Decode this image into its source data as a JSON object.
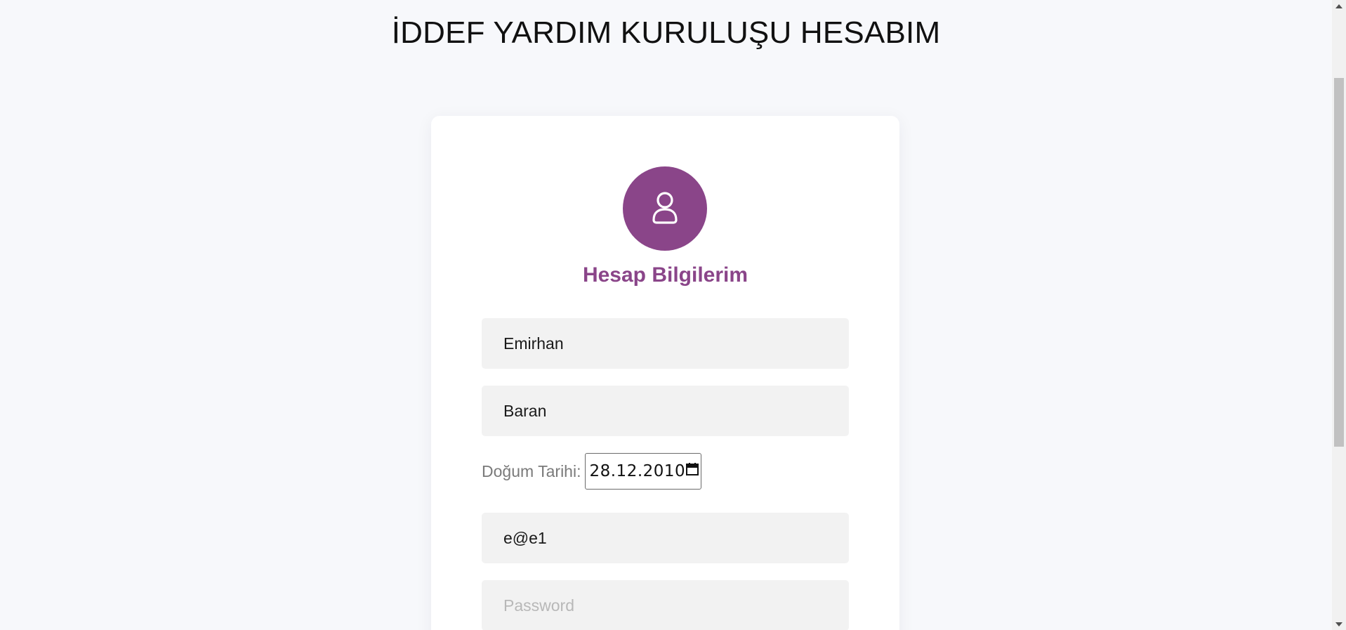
{
  "header": {
    "title": "İDDEF YARDIM KURULUŞU HESABIM"
  },
  "card": {
    "avatar_icon": "user-icon",
    "title": "Hesap Bilgilerim",
    "accent_color": "#8a4589"
  },
  "form": {
    "first_name": {
      "value": "Emirhan"
    },
    "last_name": {
      "value": "Baran"
    },
    "birth_date": {
      "label": "Doğum Tarihi:",
      "value": "28.12.2010",
      "icon": "calendar-icon"
    },
    "email": {
      "value": "e@e1"
    },
    "password": {
      "value": "",
      "placeholder": "Password"
    }
  },
  "scrollbar": {
    "up_icon": "scroll-up-icon",
    "down_icon": "scroll-down-icon"
  }
}
